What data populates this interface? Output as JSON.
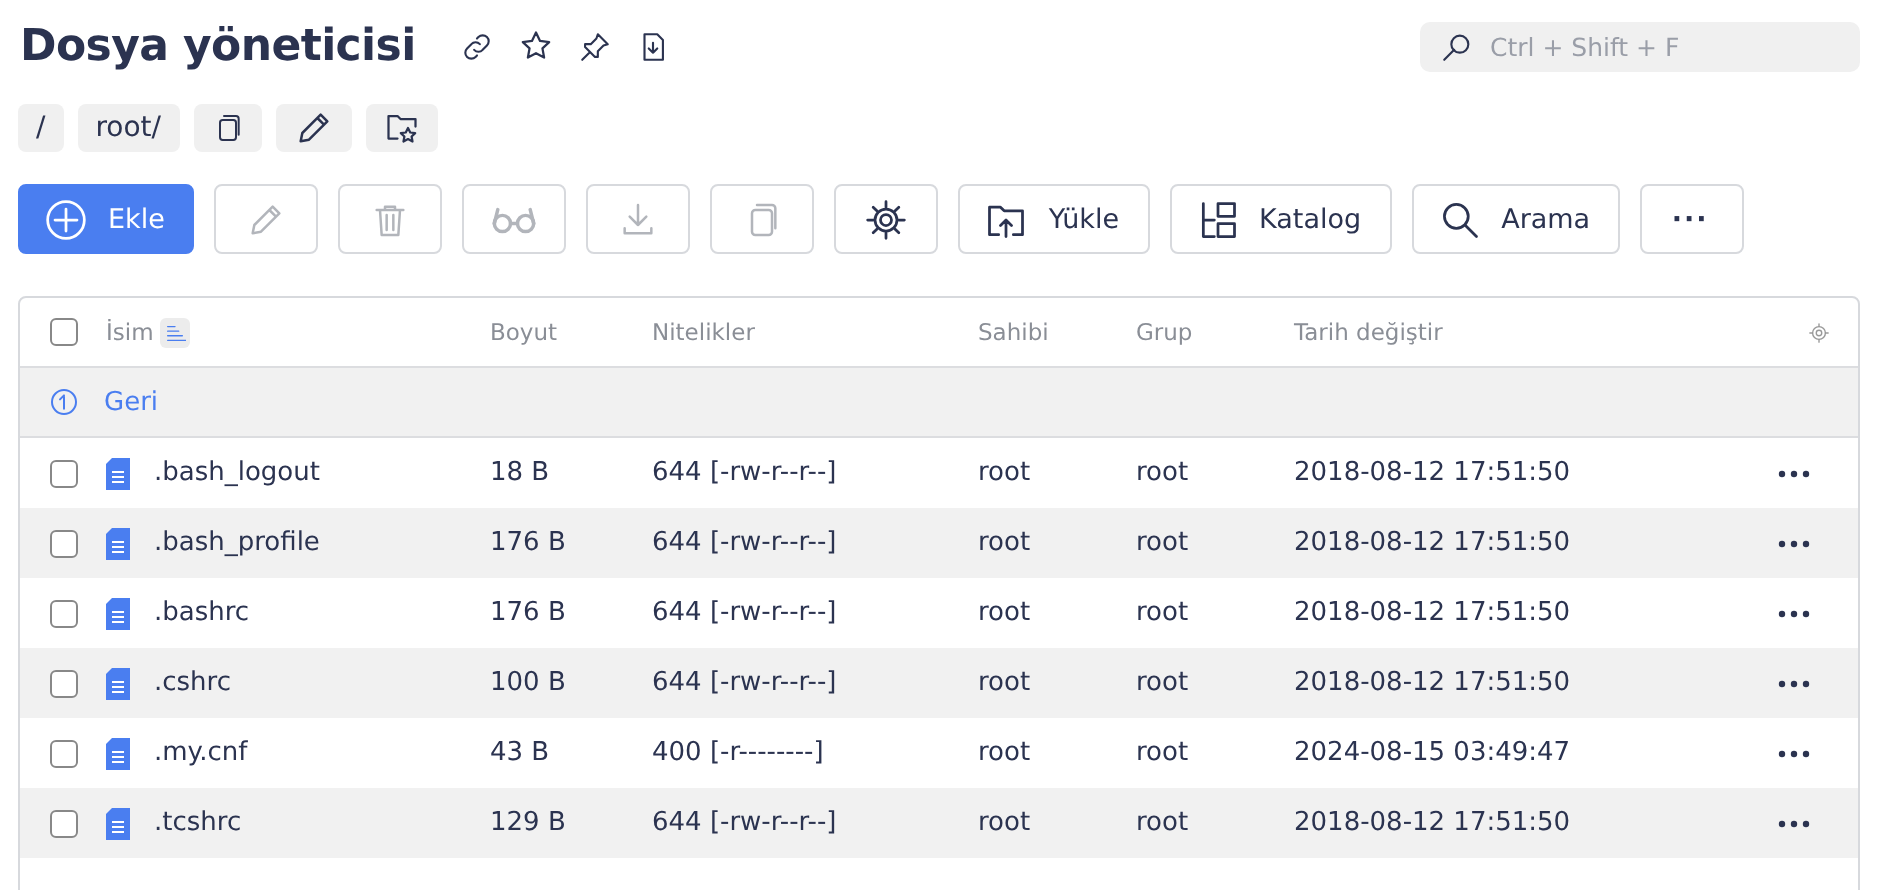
{
  "page": {
    "title": "Dosya yöneticisi",
    "search": {
      "placeholder": "Ctrl + Shift + F"
    }
  },
  "breadcrumb": [
    {
      "kind": "text",
      "label": "/"
    },
    {
      "kind": "text",
      "label": "root/"
    },
    {
      "kind": "copy"
    },
    {
      "kind": "edit"
    },
    {
      "kind": "favorite"
    }
  ],
  "toolbar": [
    {
      "kind": "add",
      "label": "Ekle",
      "primary": true,
      "disabled": false
    },
    {
      "kind": "edit",
      "primary": false,
      "disabled": true
    },
    {
      "kind": "delete",
      "primary": false,
      "disabled": true
    },
    {
      "kind": "view",
      "primary": false,
      "disabled": true
    },
    {
      "kind": "download",
      "primary": false,
      "disabled": true
    },
    {
      "kind": "copy",
      "primary": false,
      "disabled": true
    },
    {
      "kind": "settings",
      "primary": false,
      "disabled": false
    },
    {
      "kind": "upload",
      "label": "Yükle",
      "primary": false,
      "disabled": false
    },
    {
      "kind": "catalog",
      "label": "Katalog",
      "primary": false,
      "disabled": false
    },
    {
      "kind": "search",
      "label": "Arama",
      "primary": false,
      "disabled": false
    },
    {
      "kind": "more",
      "label": "···",
      "primary": false,
      "disabled": false
    }
  ],
  "table": {
    "columns": [
      "İsim",
      "Boyut",
      "Nitelikler",
      "Sahibi",
      "Grup",
      "Tarih değiştir"
    ],
    "back": "Geri",
    "select_all": false,
    "rows": [
      {
        "name": ".bash_logout",
        "size": "18 B",
        "attributes": "644 [-rw-r--r--]",
        "owner": "root",
        "group": "root",
        "modified": "2018-08-12 17:51:50",
        "checked": false
      },
      {
        "name": ".bash_profile",
        "size": "176 B",
        "attributes": "644 [-rw-r--r--]",
        "owner": "root",
        "group": "root",
        "modified": "2018-08-12 17:51:50",
        "checked": false
      },
      {
        "name": ".bashrc",
        "size": "176 B",
        "attributes": "644 [-rw-r--r--]",
        "owner": "root",
        "group": "root",
        "modified": "2018-08-12 17:51:50",
        "checked": false
      },
      {
        "name": ".cshrc",
        "size": "100 B",
        "attributes": "644 [-rw-r--r--]",
        "owner": "root",
        "group": "root",
        "modified": "2018-08-12 17:51:50",
        "checked": false
      },
      {
        "name": ".my.cnf",
        "size": "43 B",
        "attributes": "400 [-r--------]",
        "owner": "root",
        "group": "root",
        "modified": "2024-08-15 03:49:47",
        "checked": false
      },
      {
        "name": ".tcshrc",
        "size": "129 B",
        "attributes": "644 [-rw-r--r--]",
        "owner": "root",
        "group": "root",
        "modified": "2018-08-12 17:51:50",
        "checked": false
      }
    ]
  }
}
